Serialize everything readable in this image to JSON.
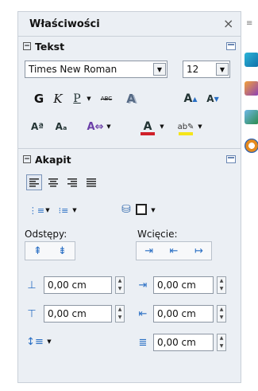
{
  "panel": {
    "title": "Właściwości",
    "close": "×"
  },
  "sections": {
    "text": "Tekst",
    "paragraph": "Akapit"
  },
  "collapse_symbol": "⊟",
  "font": {
    "name": "Times New Roman",
    "size": "12"
  },
  "format_buttons": {
    "bold": "G",
    "italic": "K",
    "underline": "P",
    "strike": "ABC",
    "shadow": "A",
    "grow": "A",
    "shrink": "A"
  },
  "paragraph": {
    "spacing_label": "Odstępy:",
    "indent_label": "Wcięcie:"
  },
  "spacing_fields": {
    "above": "0,00 cm",
    "below": "0,00 cm",
    "before": "0,00 cm",
    "after": "0,00 cm",
    "first_line": "0,00 cm"
  },
  "colors": {
    "accent": "#6a87b3",
    "font_color": "#d0202a",
    "highlight": "#f5e51a"
  }
}
